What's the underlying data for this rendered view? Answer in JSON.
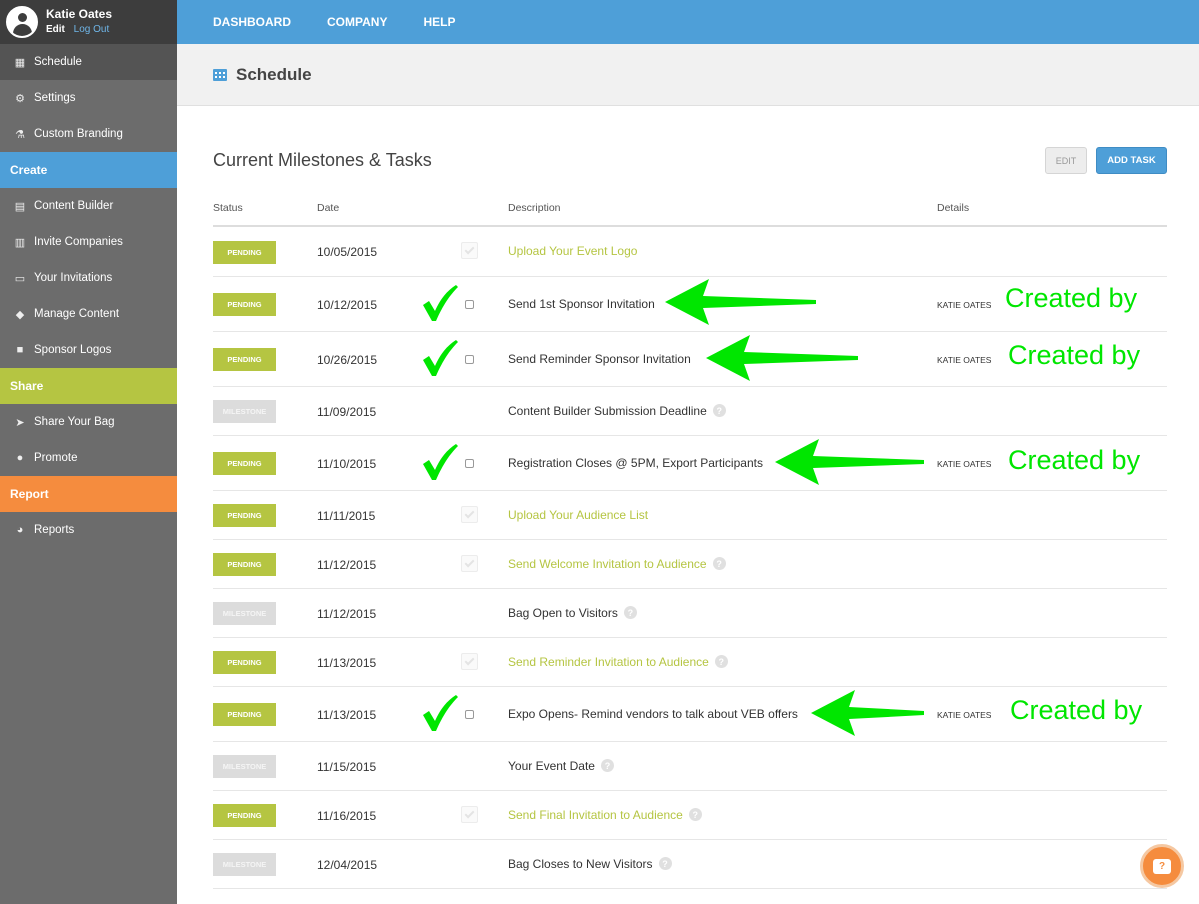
{
  "user": {
    "name": "Katie Oates",
    "edit": "Edit",
    "logout": "Log Out"
  },
  "sidebar": {
    "items_top": [
      {
        "label": "Schedule",
        "icon": "calendar-icon"
      },
      {
        "label": "Settings",
        "icon": "gear-icon"
      },
      {
        "label": "Custom Branding",
        "icon": "flask-icon"
      }
    ],
    "create_head": "Create",
    "create_items": [
      {
        "label": "Content Builder",
        "icon": "layout-icon"
      },
      {
        "label": "Invite Companies",
        "icon": "building-icon"
      },
      {
        "label": "Your Invitations",
        "icon": "inbox-icon"
      },
      {
        "label": "Manage Content",
        "icon": "tag-icon"
      },
      {
        "label": "Sponsor Logos",
        "icon": "briefcase-icon"
      }
    ],
    "share_head": "Share",
    "share_items": [
      {
        "label": "Share Your Bag",
        "icon": "send-icon"
      },
      {
        "label": "Promote",
        "icon": "globe-icon"
      }
    ],
    "report_head": "Report",
    "report_items": [
      {
        "label": "Reports",
        "icon": "pie-chart-icon"
      }
    ]
  },
  "topnav": {
    "dashboard": "DASHBOARD",
    "company": "COMPANY",
    "help": "HELP"
  },
  "header": {
    "title": "Schedule"
  },
  "main": {
    "title": "Current Milestones & Tasks",
    "edit_label": "EDIT",
    "add_task_label": "ADD TASK",
    "columns": {
      "status": "Status",
      "date": "Date",
      "description": "Description",
      "details": "Details"
    },
    "rows": [
      {
        "status": "PENDING",
        "date": "10/05/2015",
        "description": "Upload Your Event Logo",
        "details": ""
      },
      {
        "status": "PENDING",
        "date": "10/12/2015",
        "description": "Send 1st Sponsor Invitation",
        "details": "KATIE OATES"
      },
      {
        "status": "PENDING",
        "date": "10/26/2015",
        "description": "Send Reminder Sponsor Invitation",
        "details": "KATIE OATES"
      },
      {
        "status": "MILESTONE",
        "date": "11/09/2015",
        "description": "Content Builder Submission Deadline",
        "details": ""
      },
      {
        "status": "PENDING",
        "date": "11/10/2015",
        "description": "Registration Closes @ 5PM, Export Participants",
        "details": "KATIE OATES"
      },
      {
        "status": "PENDING",
        "date": "11/11/2015",
        "description": "Upload Your Audience List",
        "details": ""
      },
      {
        "status": "PENDING",
        "date": "11/12/2015",
        "description": "Send Welcome Invitation to Audience",
        "details": ""
      },
      {
        "status": "MILESTONE",
        "date": "11/12/2015",
        "description": "Bag Open to Visitors",
        "details": ""
      },
      {
        "status": "PENDING",
        "date": "11/13/2015",
        "description": "Send Reminder Invitation to Audience",
        "details": ""
      },
      {
        "status": "PENDING",
        "date": "11/13/2015",
        "description": "Expo Opens- Remind vendors to talk about VEB offers",
        "details": "KATIE OATES"
      },
      {
        "status": "MILESTONE",
        "date": "11/15/2015",
        "description": "Your Event Date",
        "details": ""
      },
      {
        "status": "PENDING",
        "date": "11/16/2015",
        "description": "Send Final Invitation to Audience",
        "details": ""
      },
      {
        "status": "MILESTONE",
        "date": "12/04/2015",
        "description": "Bag Closes to New Visitors",
        "details": ""
      }
    ]
  },
  "annotation": {
    "created_by": "Created by",
    "color": "#00e600"
  },
  "colors": {
    "blue": "#4e9fd8",
    "green": "#b5c542",
    "orange": "#f58c3e",
    "sidebar": "#6c6c6c"
  }
}
